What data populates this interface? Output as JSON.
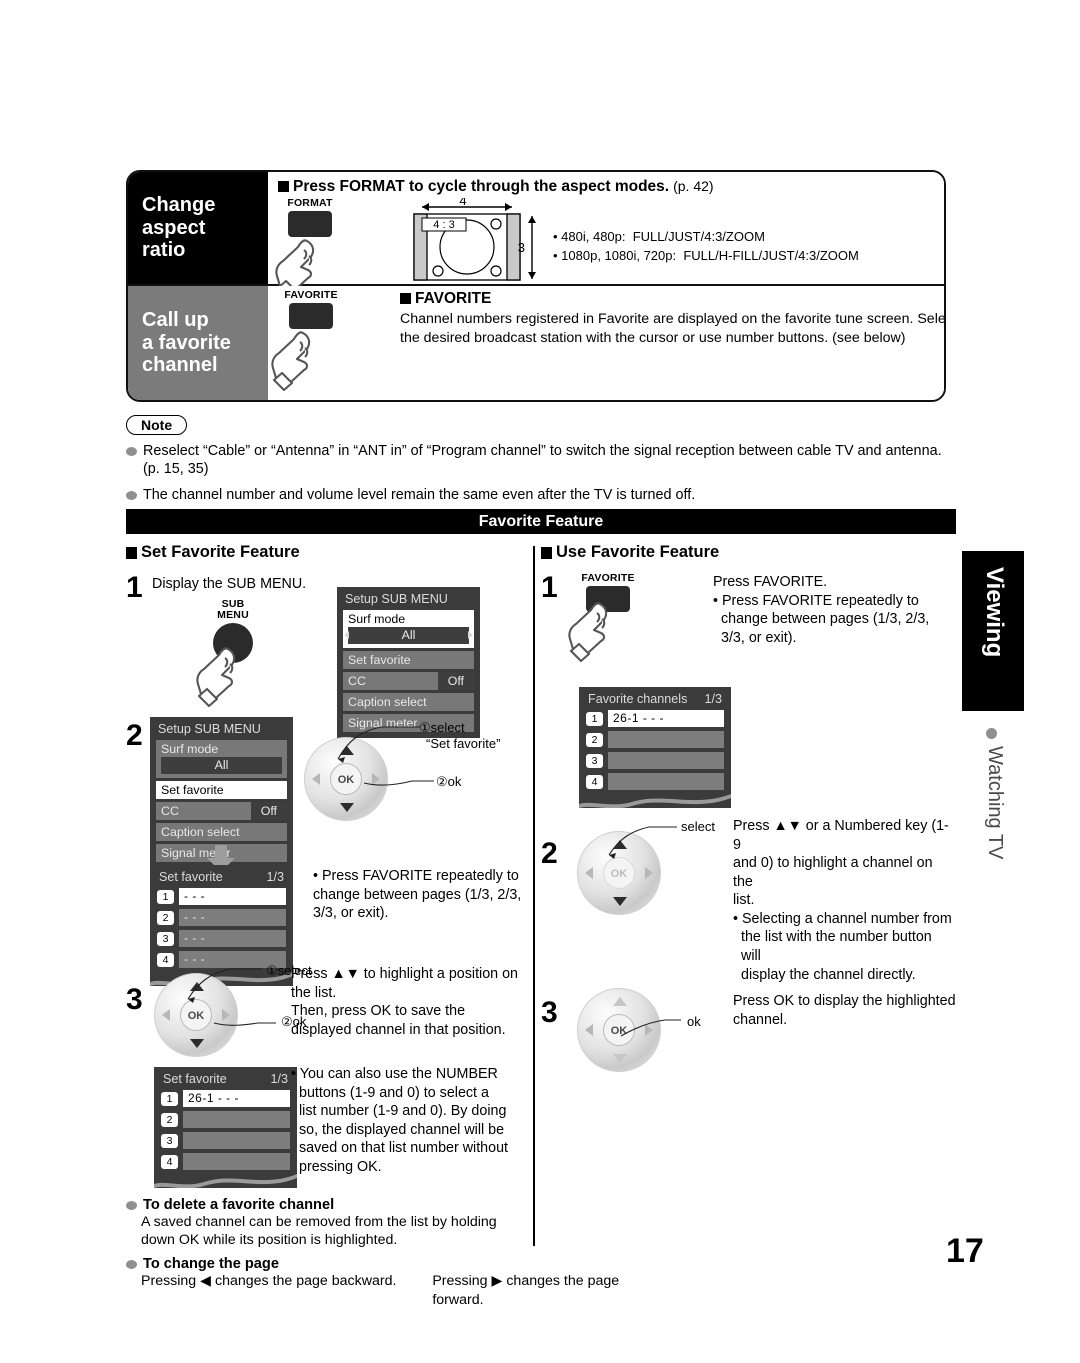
{
  "operations": [
    {
      "label": "Change\naspect\nratio",
      "label_lines": [
        "Change",
        "aspect",
        "ratio"
      ],
      "button": "FORMAT",
      "heading": "Press FORMAT to cycle through the aspect modes.",
      "heading_page": "(p. 42)",
      "diagram": {
        "width_label": "4",
        "height_label": "3",
        "inner_label": "4 : 3"
      },
      "modes": [
        "• 480i, 480p:  FULL/JUST/4:3/ZOOM",
        "• 1080p, 1080i, 720p:  FULL/H-FILL/JUST/4:3/ZOOM"
      ]
    },
    {
      "label_lines": [
        "Call up",
        "a favorite",
        "channel"
      ],
      "button": "FAVORITE",
      "heading": "FAVORITE",
      "heading_page": "",
      "description": "Channel numbers registered in Favorite are displayed on the favorite tune screen. Select the desired broadcast station with the cursor or use number buttons. (see below)"
    }
  ],
  "note": {
    "title": "Note",
    "items": [
      "Reselect “Cable” or “Antenna” in “ANT in” of “Program channel” to switch the signal reception between cable TV and antenna. (p. 15, 35)",
      "The channel number and volume level remain the same even after the TV is turned off."
    ]
  },
  "banner": {
    "title": "Favorite Feature"
  },
  "left_column": {
    "heading": "Set Favorite Feature",
    "step1": {
      "num": "1",
      "text": "Display the SUB MENU.",
      "button_line1": "SUB",
      "button_line2": "MENU",
      "osd": {
        "title": "Setup SUB MENU",
        "surf_label": "Surf mode",
        "surf_value": "All",
        "surf_highlight": true,
        "items": [
          {
            "label": "Set favorite",
            "value": "",
            "highlight": false
          },
          {
            "label": "CC",
            "value": "Off",
            "highlight": false
          },
          {
            "label": "Caption select",
            "value": "",
            "highlight": false
          },
          {
            "label": "Signal meter",
            "value": "",
            "highlight": false
          }
        ]
      }
    },
    "step2": {
      "num": "2",
      "osd": {
        "title": "Setup SUB MENU",
        "surf_label": "Surf mode",
        "surf_value": "All",
        "surf_highlight": false,
        "items": [
          {
            "label": "Set favorite",
            "value": "",
            "highlight": true
          },
          {
            "label": "CC",
            "value": "Off",
            "highlight": false
          },
          {
            "label": "Caption select",
            "value": "",
            "highlight": false
          },
          {
            "label": "Signal meter",
            "value": "",
            "highlight": false
          }
        ]
      },
      "callout1": "①select",
      "callout1b": "“Set favorite”",
      "callout2": "②ok",
      "pad_ok": "OK",
      "favpanel": {
        "title": "Set favorite",
        "page": "1/3",
        "rows": [
          {
            "key": "1",
            "value": "- - -",
            "highlight": true
          },
          {
            "key": "2",
            "value": "- - -",
            "highlight": false
          },
          {
            "key": "3",
            "value": "- - -",
            "highlight": false
          },
          {
            "key": "4",
            "value": "- - -",
            "highlight": false
          }
        ]
      },
      "note_bullet": "• Press FAVORITE repeatedly to change between pages (1/3, 2/3, 3/3, or exit)."
    },
    "step3": {
      "num": "3",
      "callout1": "①select",
      "callout2": "②ok",
      "pad_ok": "OK",
      "text": "Press ▲▼ to highlight a position on the list.\nThen, press OK to save the displayed channel in that position.",
      "text_lines": [
        "Press ▲▼ to highlight a position on",
        "the list.",
        "Then, press OK to save the",
        "displayed channel in that position."
      ],
      "favpanel": {
        "title": "Set favorite",
        "page": "1/3",
        "rows": [
          {
            "key": "1",
            "value": "26-1      - - -",
            "highlight": true
          },
          {
            "key": "2",
            "value": "",
            "highlight": false
          },
          {
            "key": "3",
            "value": "",
            "highlight": false
          },
          {
            "key": "4",
            "value": "",
            "highlight": false
          }
        ]
      },
      "note_bullet_lines": [
        "• You can also use the NUMBER",
        "buttons (1-9 and 0) to select a",
        "list number (1-9 and 0). By doing",
        "so, the displayed channel will be",
        "saved on that list number without",
        "pressing OK."
      ]
    },
    "sub1": {
      "heading": "To delete a favorite channel",
      "lines": [
        "A saved channel can be removed from the list by holding",
        "down OK while its position is highlighted."
      ]
    },
    "sub2": {
      "heading": "To change the page",
      "left": "Pressing ◀ changes the page backward.",
      "right": "Pressing ▶ changes the page forward."
    }
  },
  "right_column": {
    "heading": "Use Favorite Feature",
    "step1": {
      "num": "1",
      "button": "FAVORITE",
      "text": "Press FAVORITE.",
      "bullet_lines": [
        "• Press FAVORITE repeatedly to",
        "change between pages (1/3, 2/3,",
        "3/3, or exit)."
      ],
      "favpanel": {
        "title": "Favorite channels",
        "page": "1/3",
        "rows": [
          {
            "key": "1",
            "value": "26-1      - - -",
            "highlight": true
          },
          {
            "key": "2",
            "value": "",
            "highlight": false
          },
          {
            "key": "3",
            "value": "",
            "highlight": false
          },
          {
            "key": "4",
            "value": "",
            "highlight": false
          }
        ]
      }
    },
    "step2": {
      "num": "2",
      "callout": "select",
      "pad_ok": "OK",
      "text_lines": [
        "Press ▲▼ or a Numbered key (1-9",
        "and 0) to highlight a channel on the",
        "list."
      ],
      "bullet_lines": [
        "• Selecting a channel number from",
        "the list with the number button will",
        "display the channel directly."
      ]
    },
    "step3": {
      "num": "3",
      "callout": "ok",
      "pad_ok": "OK",
      "text_lines": [
        "Press OK to display the highlighted",
        "channel."
      ]
    }
  },
  "side_tab": {
    "title": "Viewing",
    "subtitle": "Watching TV"
  },
  "page_number": "17"
}
